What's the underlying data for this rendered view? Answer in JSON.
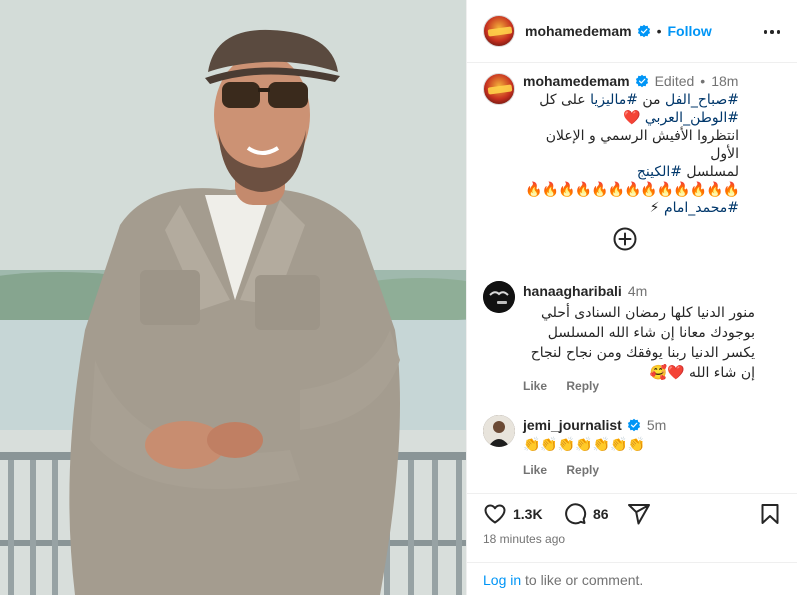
{
  "post": {
    "author": {
      "username": "mohamedemam",
      "verified": true,
      "follow_label": "Follow",
      "separator": "•"
    },
    "more_icon": "more-horizontal-icon",
    "caption": {
      "username": "mohamedemam",
      "edited_label": "Edited",
      "dot": "•",
      "time": "18m",
      "line1_tag1": "#صباح_الفل",
      "line1_word1": "من",
      "line1_tag2": "#ماليزيا",
      "line1_word2": "على كل",
      "line2_tag": "#الوطن_العربي",
      "line2_heart": "❤️",
      "line3": "انتظروا الأفيش الرسمي و الإعلان الأول",
      "line4_text": "لمسلسل",
      "line4_tag": "#الكينج",
      "fire_line": "🔥🔥🔥🔥🔥🔥🔥🔥🔥🔥🔥🔥🔥",
      "line6_tag": "#محمد_امام",
      "line6_emoji": "⚡"
    },
    "load_more_icon": "plus-circle-icon",
    "comments": [
      {
        "username": "hanaagharibali",
        "time": "4m",
        "text": "منور الدنيا كلها رمضان السنادى أحلي بوجودك معانا إن شاء الله المسلسل يكسر الدنيا ربنا يوفقك ومن نجاح لنجاح إن شاء الله ❤️🥰",
        "like_label": "Like",
        "reply_label": "Reply"
      },
      {
        "username": "jemi_journalist",
        "verified": true,
        "time": "5m",
        "text": "👏👏👏👏👏👏👏",
        "like_label": "Like",
        "reply_label": "Reply"
      }
    ],
    "actions": {
      "likes": "1.3K",
      "comments": "86",
      "like_icon": "heart-icon",
      "comment_icon": "comment-icon",
      "share_icon": "share-icon",
      "save_icon": "bookmark-icon"
    },
    "posted_ago": "18 minutes ago",
    "login_prompt": {
      "link": "Log in",
      "rest": " to like or comment."
    }
  },
  "colors": {
    "accent": "#0095f6",
    "hashtag": "#00376b",
    "muted": "#737373",
    "text": "#262626",
    "border": "#efefef",
    "heart": "#ed4956"
  }
}
